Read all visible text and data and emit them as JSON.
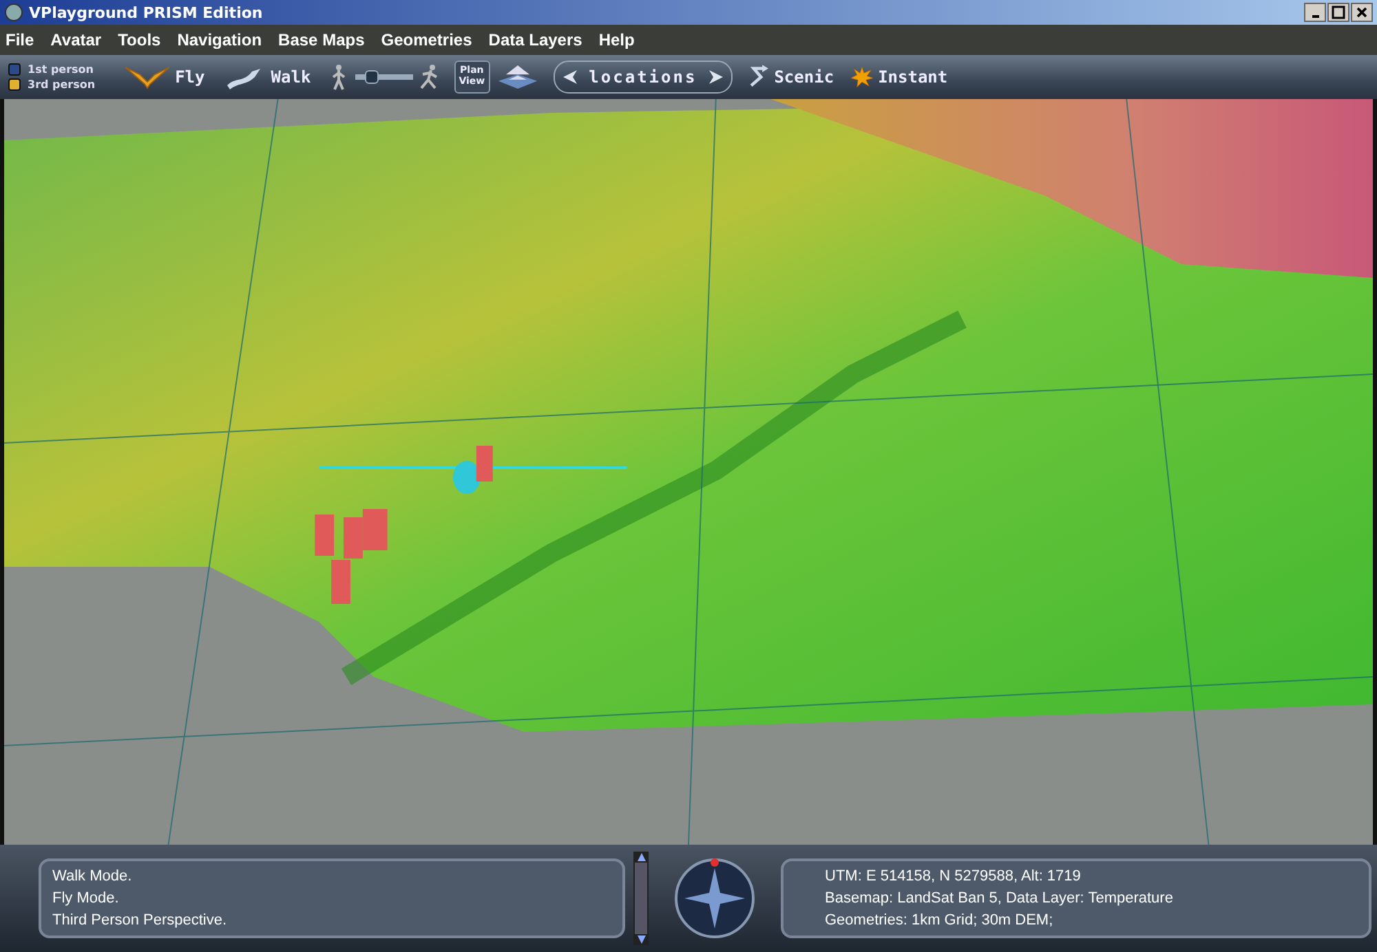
{
  "window": {
    "title": "VPlayground PRISM Edition"
  },
  "menu": [
    "File",
    "Avatar",
    "Tools",
    "Navigation",
    "Base Maps",
    "Geometries",
    "Data Layers",
    "Help"
  ],
  "perspective": [
    {
      "label": "1st person",
      "selected": false
    },
    {
      "label": "3rd person",
      "selected": true
    }
  ],
  "toolbar": {
    "fly": "Fly",
    "walk": "Walk",
    "speed": {
      "level": 0.3
    },
    "plan_view": "Plan View",
    "locations": "locations",
    "scenic": "Scenic",
    "instant": "Instant"
  },
  "messages": [
    "Walk Mode.",
    "Fly Mode.",
    "Third Person Perspective."
  ],
  "status": [
    "UTM: E 514158, N 5279588, Alt: 1719",
    "Basemap: LandSat Ban 5, Data Layer: Temperature",
    "Geometries: 1km Grid; 30m DEM;"
  ]
}
